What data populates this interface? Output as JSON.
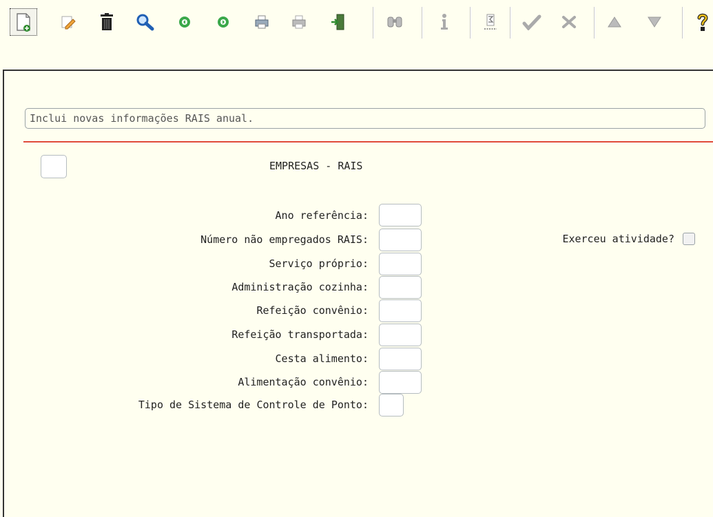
{
  "toolbar": {
    "icons": [
      "new-icon",
      "edit-icon",
      "delete-icon",
      "search-icon",
      "previous-icon",
      "next-icon",
      "print-icon",
      "print-preview-icon",
      "exit-icon",
      "find-icon",
      "info-icon",
      "sum-icon",
      "confirm-icon",
      "cancel-icon",
      "first-icon",
      "last-icon",
      "help-icon"
    ]
  },
  "form": {
    "status_message": "Inclui novas informações RAIS anual.",
    "title": "EMPRESAS - RAIS",
    "fields": [
      {
        "label": "Ano referência:"
      },
      {
        "label": "Número não empregados RAIS:"
      },
      {
        "label": "Serviço próprio:"
      },
      {
        "label": "Administração cozinha:"
      },
      {
        "label": "Refeição convênio:"
      },
      {
        "label": "Refeição transportada:"
      },
      {
        "label": "Cesta alimento:"
      },
      {
        "label": "Alimentação convênio:"
      },
      {
        "label": "Tipo de Sistema de Controle de Ponto:"
      }
    ],
    "exerceu_label": "Exerceu atividade?"
  },
  "colors": {
    "background": "#fffff0",
    "accent_line": "#e04a3a",
    "input_border": "#b5bcc0"
  }
}
